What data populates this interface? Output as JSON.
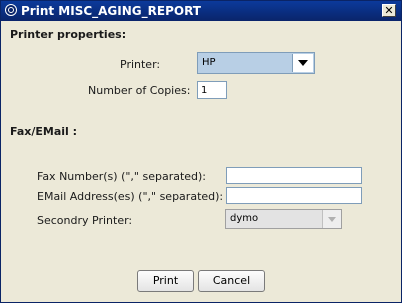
{
  "window": {
    "title": "Print MISC_AGING_REPORT",
    "close_glyph": "✕"
  },
  "printer_properties": {
    "heading": "Printer properties:",
    "printer_label": "Printer:",
    "printer_value": "HP",
    "copies_label": "Number of Copies:",
    "copies_value": "1"
  },
  "fax_email": {
    "heading": "Fax/EMail :",
    "fax_label": "Fax Number(s) (\",\" separated):",
    "fax_value": "",
    "email_label": "EMail Address(es) (\",\" separated):",
    "email_value": "",
    "secondary_label": "Secondry Printer:",
    "secondary_value": "dymo"
  },
  "buttons": {
    "print": "Print",
    "cancel": "Cancel"
  },
  "icons": {
    "title": "app-logo-icon",
    "close": "close-icon",
    "dropdown": "chevron-down-icon"
  }
}
